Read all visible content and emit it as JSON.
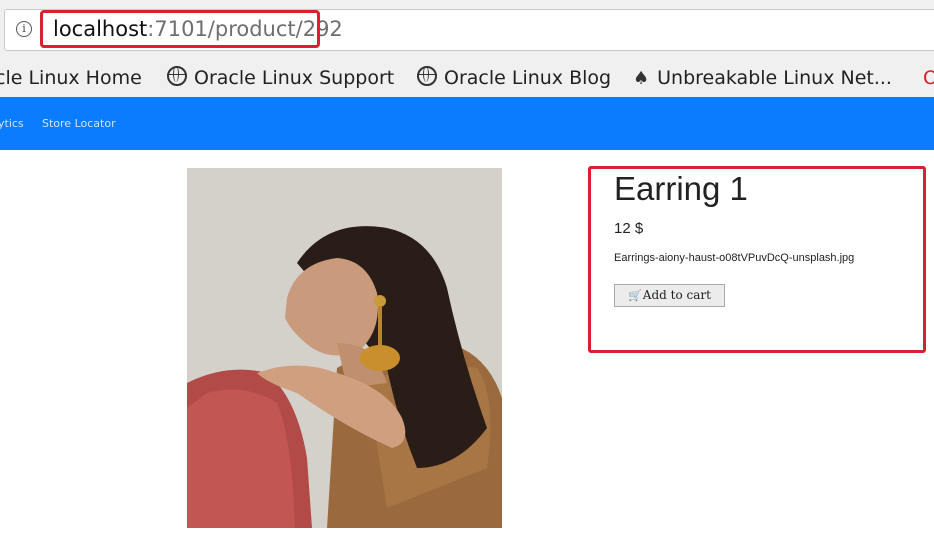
{
  "browser": {
    "url_host": "localhost",
    "url_path": ":7101/product/292",
    "info_icon": "info-icon"
  },
  "bookmarks": {
    "items": [
      {
        "label": "cle Linux Home",
        "icon": "none"
      },
      {
        "label": "Oracle Linux Support",
        "icon": "globe-icon"
      },
      {
        "label": "Oracle Linux Blog",
        "icon": "globe-icon"
      },
      {
        "label": "Unbreakable Linux Net...",
        "icon": "tux-icon"
      }
    ]
  },
  "navbar": {
    "color": "#0a7cff",
    "items": [
      "ytics",
      "Store Locator"
    ]
  },
  "product": {
    "title": "Earring 1",
    "price": "12 $",
    "image_file": "Earrings-aiony-haust-o08tVPuvDcQ-unsplash.jpg",
    "add_to_cart_label": "Add to cart",
    "cart_icon": "cart-icon"
  },
  "highlight_color": "#d9202d"
}
